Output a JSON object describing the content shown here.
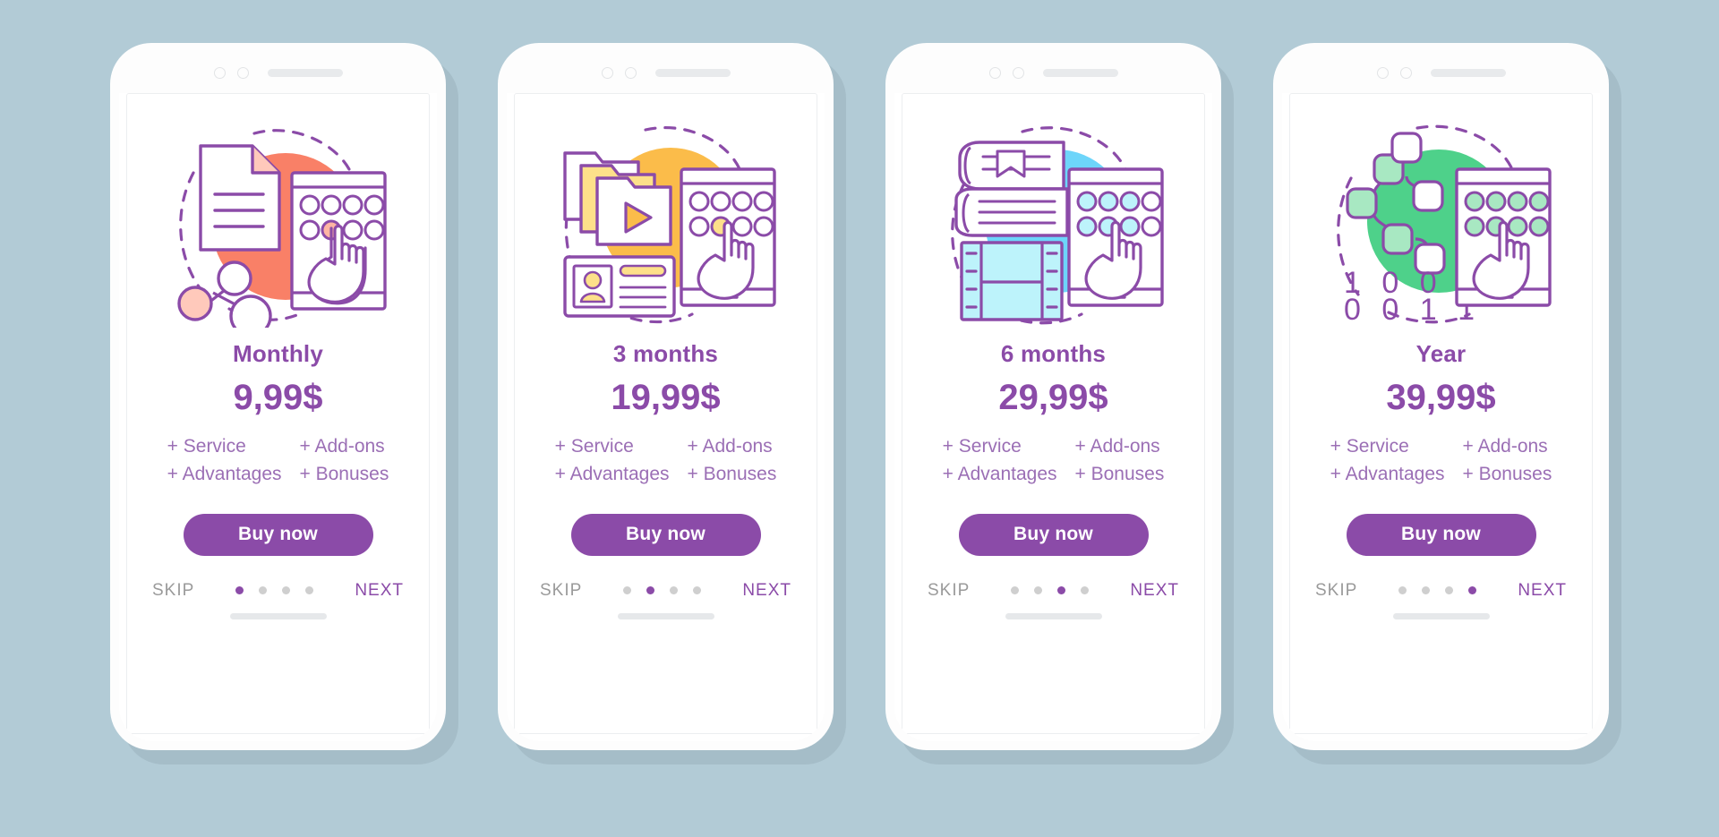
{
  "background_color": "#b2cbd6",
  "accent_color": "#8b4ba8",
  "feature_text_color": "#9b6fb5",
  "skip_color": "#9a9a9a",
  "cards": [
    {
      "id": "monthly",
      "title": "Monthly",
      "price": "9,99$",
      "features": [
        "+ Service",
        "+ Add-ons",
        "+ Advantages",
        "+ Bonuses"
      ],
      "buy_label": "Buy now",
      "skip_label": "SKIP",
      "next_label": "NEXT",
      "active_dot": 0,
      "dot_count": 4,
      "illustration": "document-share",
      "blob_color": "#f98067",
      "accent_fill": "#ffb5a3"
    },
    {
      "id": "three-months",
      "title": "3 months",
      "price": "19,99$",
      "features": [
        "+ Service",
        "+ Add-ons",
        "+ Advantages",
        "+ Bonuses"
      ],
      "buy_label": "Buy now",
      "skip_label": "SKIP",
      "next_label": "NEXT",
      "active_dot": 1,
      "dot_count": 4,
      "illustration": "video-folder-contact",
      "blob_color": "#fbbc4a",
      "accent_fill": "#fde08a"
    },
    {
      "id": "six-months",
      "title": "6 months",
      "price": "29,99$",
      "features": [
        "+ Service",
        "+ Add-ons",
        "+ Advantages",
        "+ Bonuses"
      ],
      "buy_label": "Buy now",
      "skip_label": "SKIP",
      "next_label": "NEXT",
      "active_dot": 2,
      "dot_count": 4,
      "illustration": "books-film",
      "blob_color": "#6dd5fa",
      "accent_fill": "#bdf3fb"
    },
    {
      "id": "year",
      "title": "Year",
      "price": "39,99$",
      "features": [
        "+ Service",
        "+ Add-ons",
        "+ Advantages",
        "+ Bonuses"
      ],
      "buy_label": "Buy now",
      "skip_label": "SKIP",
      "next_label": "NEXT",
      "active_dot": 3,
      "dot_count": 4,
      "illustration": "binary-nodes",
      "blob_color": "#4ed18a",
      "accent_fill": "#b7ee c9",
      "binary_line_1": "1 0 0 1",
      "binary_line_2": "0 0 1 1"
    }
  ]
}
